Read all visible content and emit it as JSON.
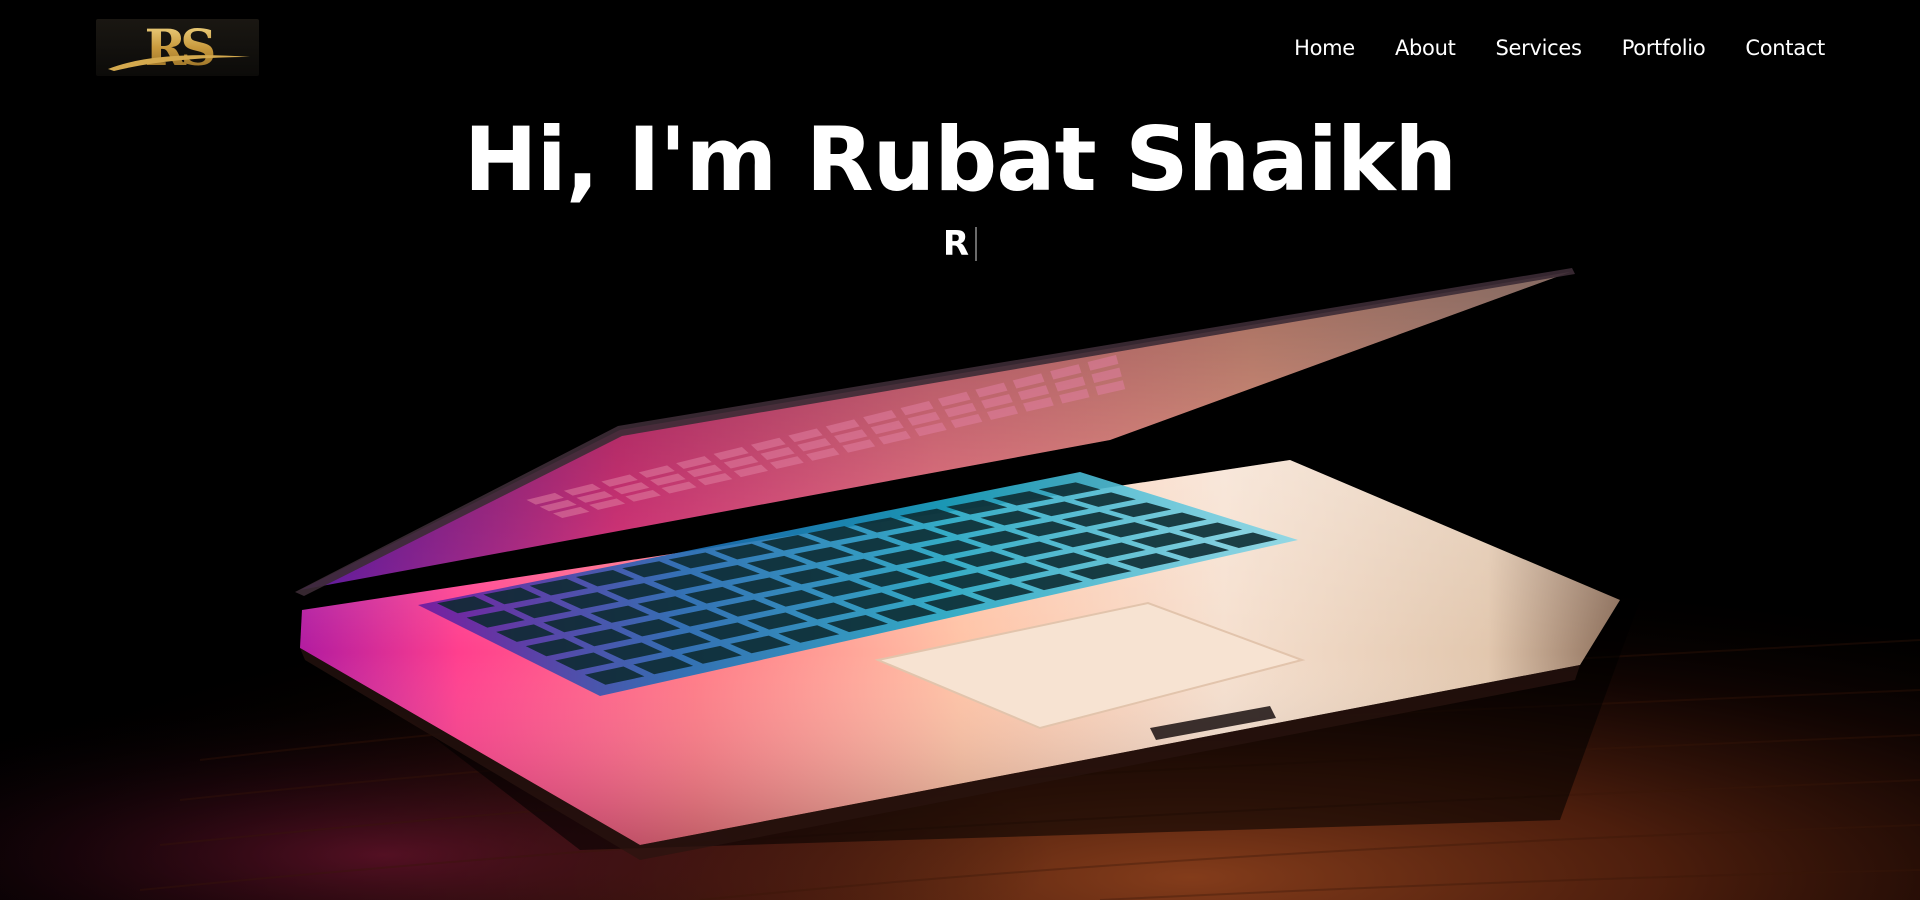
{
  "logo": {
    "text": "RS",
    "alt": "RS logo"
  },
  "nav": {
    "items": [
      {
        "label": "Home"
      },
      {
        "label": "About"
      },
      {
        "label": "Services"
      },
      {
        "label": "Portfolio"
      },
      {
        "label": "Contact"
      }
    ]
  },
  "hero": {
    "headline": "Hi, I'm Rubat Shaikh",
    "typed_text": "R"
  },
  "colors": {
    "background": "#000000",
    "text": "#ffffff",
    "logo_gold": "#d4a94e"
  }
}
